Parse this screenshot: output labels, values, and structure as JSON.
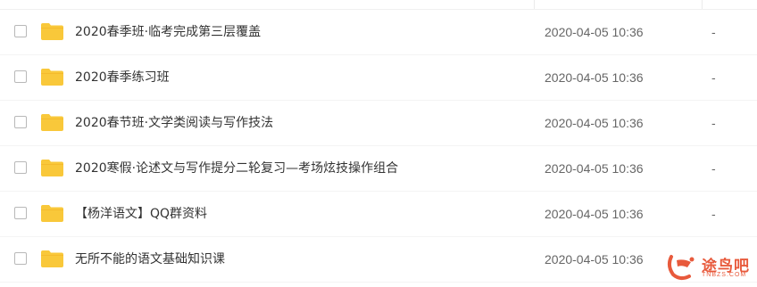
{
  "files": [
    {
      "name": "2020春季班·临考完成第三层覆盖",
      "modified": "2020-04-05 10:36",
      "size": "-"
    },
    {
      "name": "2020春季练习班",
      "modified": "2020-04-05 10:36",
      "size": "-"
    },
    {
      "name": "2020春节班·文学类阅读与写作技法",
      "modified": "2020-04-05 10:36",
      "size": "-"
    },
    {
      "name": "2020寒假·论述文与写作提分二轮复习—考场炫技操作组合",
      "modified": "2020-04-05 10:36",
      "size": "-"
    },
    {
      "name": "【杨洋语文】QQ群资料",
      "modified": "2020-04-05 10:36",
      "size": "-"
    },
    {
      "name": "无所不能的语文基础知识课",
      "modified": "2020-04-05 10:36",
      "size": "-"
    }
  ],
  "icons": {
    "row_folder": "folder-icon",
    "row_select": "checkbox"
  },
  "colors": {
    "folder": "#f9c83a",
    "watermark": "#e85a3c"
  },
  "watermark": {
    "text": "途鸟吧",
    "sub": "TNBZS.COM"
  }
}
